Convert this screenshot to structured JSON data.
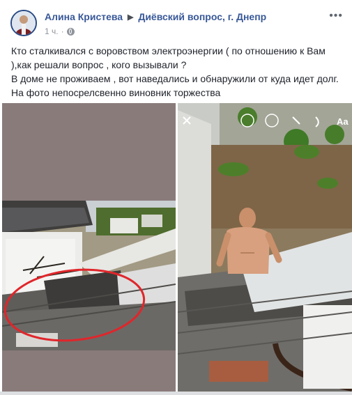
{
  "post": {
    "author": "Алина Кристева",
    "group": "Диёвский вопрос, г. Днепр",
    "time": "1 ч.",
    "text_lines": [
      "Кто сталкивался с воровством электроэнергии ( по отношению к Вам",
      "),как решали вопрос , кого вызывали ?",
      "В доме не проживаем , вот наведались и обнаружили от куда идет долг.",
      "На фото непосрелсвенно виновник торжества"
    ]
  },
  "icons": {
    "more": "more-options-icon",
    "privacy": "globe-icon",
    "story_close": "close-icon",
    "story_text": "Aa"
  },
  "colors": {
    "link": "#385898",
    "text": "#1d2129",
    "meta": "#90949c",
    "annotation": "#e0262b"
  }
}
